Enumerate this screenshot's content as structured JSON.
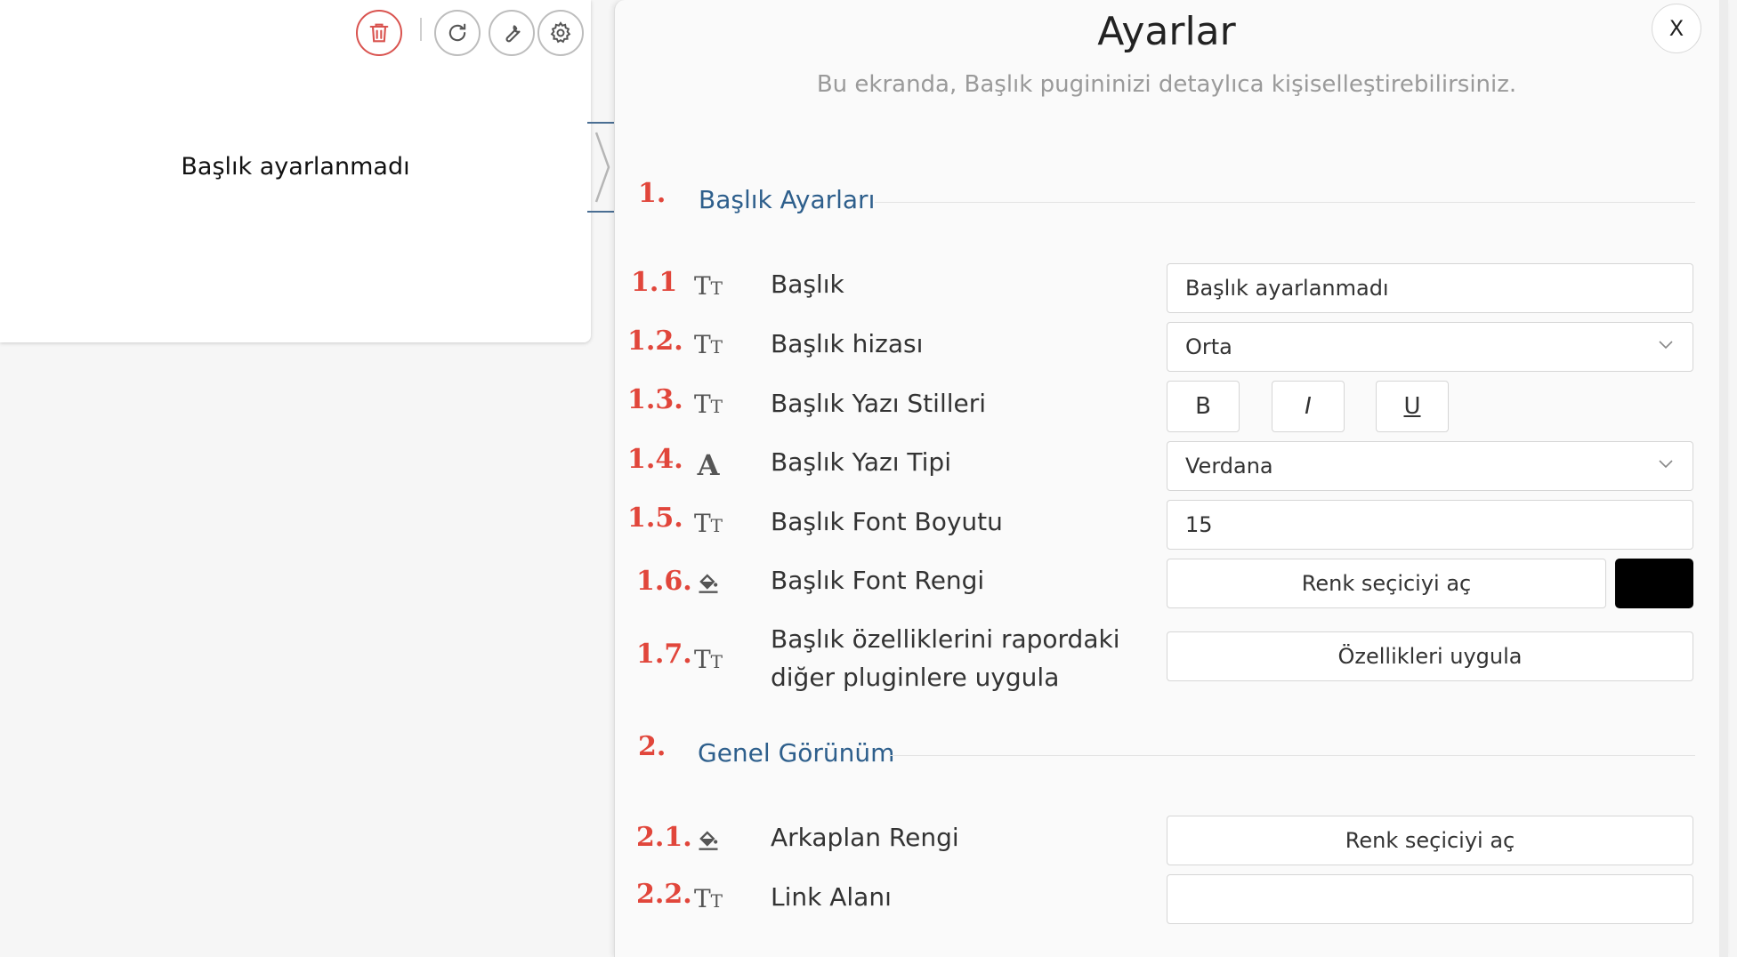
{
  "widget": {
    "title": "Başlık ayarlanmadı",
    "toolbar": {
      "delete_icon": "trash-icon",
      "refresh_icon": "refresh-icon",
      "wrench_icon": "wrench-icon",
      "settings_icon": "gear-icon"
    }
  },
  "panel": {
    "title": "Ayarlar",
    "subtitle": "Bu ekranda, Başlık pugininizi detaylıca kişiselleştirebilirsiniz.",
    "close_label": "X",
    "sections": [
      {
        "number": "1.",
        "title": "Başlık Ayarları",
        "rows": [
          {
            "number": "1.1",
            "icon": "text-size-icon",
            "label": "Başlık",
            "control": "input",
            "value": "Başlık ayarlanmadı"
          },
          {
            "number": "1.2.",
            "icon": "text-size-icon",
            "label": "Başlık hizası",
            "control": "select",
            "value": "Orta"
          },
          {
            "number": "1.3.",
            "icon": "text-size-icon",
            "label": "Başlık Yazı Stilleri",
            "control": "style-buttons",
            "buttons": [
              "B",
              "I",
              "U"
            ]
          },
          {
            "number": "1.4.",
            "icon": "font-icon",
            "label": "Başlık Yazı Tipi",
            "control": "select",
            "value": "Verdana"
          },
          {
            "number": "1.5.",
            "icon": "text-size-icon",
            "label": "Başlık Font Boyutu",
            "control": "input",
            "value": "15"
          },
          {
            "number": "1.6.",
            "icon": "paint-bucket-icon",
            "label": "Başlık Font Rengi",
            "control": "color",
            "button_label": "Renk seçiciyi aç",
            "color": "#000000"
          },
          {
            "number": "1.7.",
            "icon": "text-size-icon",
            "label_line1": "Başlık özelliklerini rapordaki",
            "label_line2": "diğer pluginlere uygula",
            "control": "button",
            "button_label": "Özellikleri uygula"
          }
        ]
      },
      {
        "number": "2.",
        "title": "Genel Görünüm",
        "rows": [
          {
            "number": "2.1.",
            "icon": "paint-bucket-icon",
            "label": "Arkaplan Rengi",
            "control": "button",
            "button_label": "Renk seçiciyi aç"
          },
          {
            "number": "2.2.",
            "icon": "text-size-icon",
            "label": "Link Alanı",
            "control": "input",
            "value": ""
          }
        ]
      }
    ]
  },
  "colors": {
    "accent_number": "#e1463b",
    "section_title": "#2e5f8c",
    "delete": "#d9534f",
    "font_color_swatch": "#000000"
  }
}
